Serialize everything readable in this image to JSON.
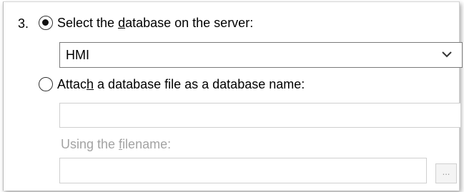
{
  "step_number": "3.",
  "option_select": {
    "label_pre": "Select the ",
    "label_key": "d",
    "label_post": "atabase on the server:",
    "selected": true
  },
  "database_select": {
    "value": "HMI"
  },
  "option_attach": {
    "label_pre": "Attac",
    "label_key": "h",
    "label_post": " a database file as a database name:",
    "selected": false
  },
  "database_name_field": {
    "value": ""
  },
  "filename_label": {
    "pre": "Using the ",
    "key": "f",
    "post": "ilename:"
  },
  "filename_field": {
    "value": ""
  },
  "browse_button": {
    "label": "..."
  },
  "colors": {
    "disabled_text": "#a3a3a3",
    "border": "#7a7a7a"
  }
}
